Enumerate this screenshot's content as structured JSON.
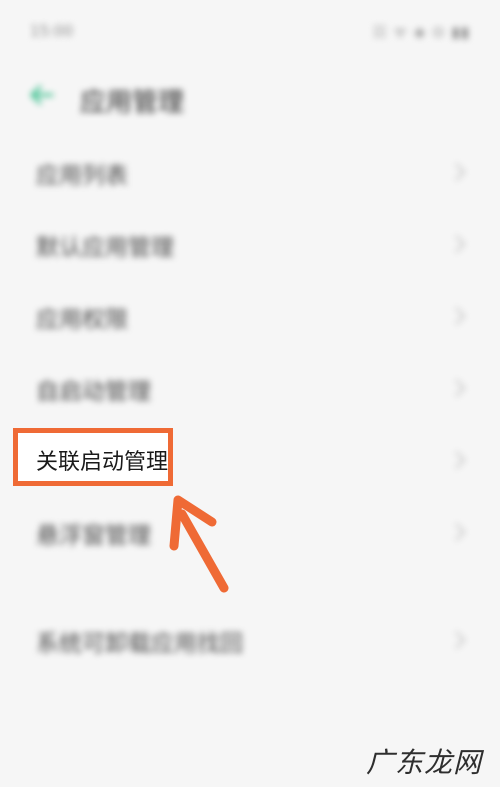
{
  "status_bar": {
    "time": "15:00",
    "icons": "☷ ᯤ ◈ ⊙ ▮▮"
  },
  "header": {
    "title": "应用管理",
    "back_icon": "back-arrow-icon",
    "accent": "#3cc08e"
  },
  "menu": {
    "items": [
      {
        "label": "应用列表"
      },
      {
        "label": "默认应用管理"
      },
      {
        "label": "应用权限"
      },
      {
        "label": "自启动管理"
      },
      {
        "label": "关联启动管理",
        "highlighted": true
      },
      {
        "label": "悬浮窗管理"
      },
      {
        "label": "系统可卸载应用找回"
      }
    ]
  },
  "annotation": {
    "highlight_color": "#ef6a35",
    "arrow_icon": "pointer-arrow-icon"
  },
  "watermark": "广东龙网"
}
